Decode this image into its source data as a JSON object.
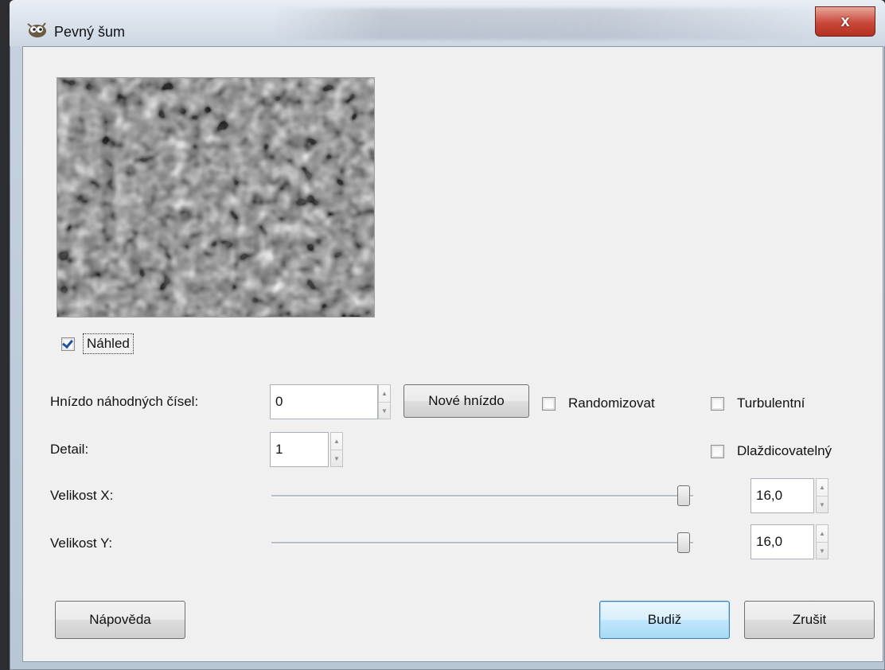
{
  "window": {
    "title": "Pevný šum",
    "close_label": "x"
  },
  "preview": {
    "checkbox_label": "Náhled",
    "checked": true
  },
  "seed": {
    "label": "Hnízdo náhodných čísel:",
    "value": "0",
    "new_seed_button": "Nové hnízdo",
    "randomize_label": "Randomizovat",
    "turbulent_label": "Turbulentní"
  },
  "detail": {
    "label": "Detail:",
    "value": "1",
    "tileable_label": "Dlaždicovatelný"
  },
  "size_x": {
    "label": "Velikost X:",
    "value": "16,0"
  },
  "size_y": {
    "label": "Velikost Y:",
    "value": "16,0"
  },
  "buttons": {
    "help": "Nápověda",
    "ok": "Budiž",
    "cancel": "Zrušit"
  },
  "icons": [
    "gimp-wilber-icon",
    "close-icon",
    "spin-up-icon",
    "spin-down-icon",
    "check-icon"
  ]
}
